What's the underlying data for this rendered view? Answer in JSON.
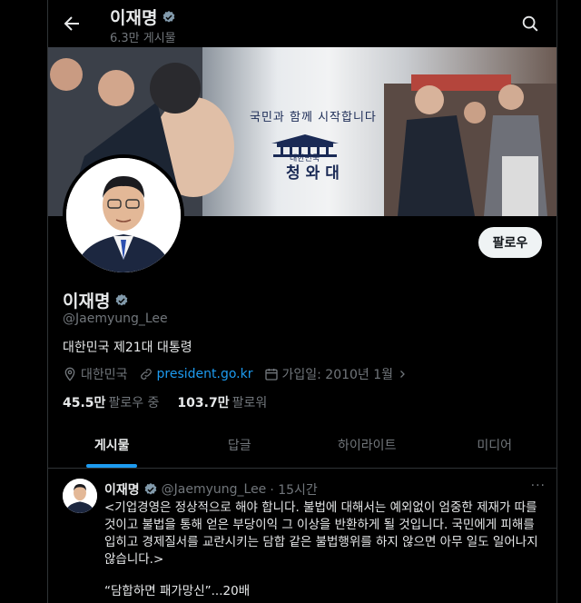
{
  "header": {
    "name": "이재명",
    "post_count": "6.3만 게시물"
  },
  "banner": {
    "slogan": "국민과 함께 시작합니다",
    "logo_subtitle": "대한민국",
    "logo_title": "청와대"
  },
  "profile": {
    "name": "이재명",
    "handle": "@Jaemyung_Lee",
    "bio": "대한민국 제21대 대통령",
    "location": "대한민국",
    "website": "president.go.kr",
    "joined": "가입일: 2010년 1월",
    "following_count": "45.5만",
    "following_label": "팔로우 중",
    "followers_count": "103.7만",
    "followers_label": "팔로워",
    "follow_button": "팔로우"
  },
  "tabs": [
    {
      "label": "게시물"
    },
    {
      "label": "답글"
    },
    {
      "label": "하이라이트"
    },
    {
      "label": "미디어"
    }
  ],
  "tweet": {
    "name": "이재명",
    "handle": "@Jaemyung_Lee",
    "time": "· 15시간",
    "body": "<기업경영은 정상적으로 해야 합니다. 불법에 대해서는 예외없이 엄중한 제재가 따를 것이고 불법을 통해 얻은 부당이익 그 이상을 반환하게 될 것입니다. 국민에게 피해를 입히고 경제질서를 교란시키는 담합 같은 불법행위를 하지 않으면 아무 일도 일어나지 않습니다.>",
    "quote": "“담합하면 패가망신”...20배"
  },
  "colors": {
    "accent": "#1d9bf0",
    "background": "#000000",
    "muted": "#71767b"
  }
}
